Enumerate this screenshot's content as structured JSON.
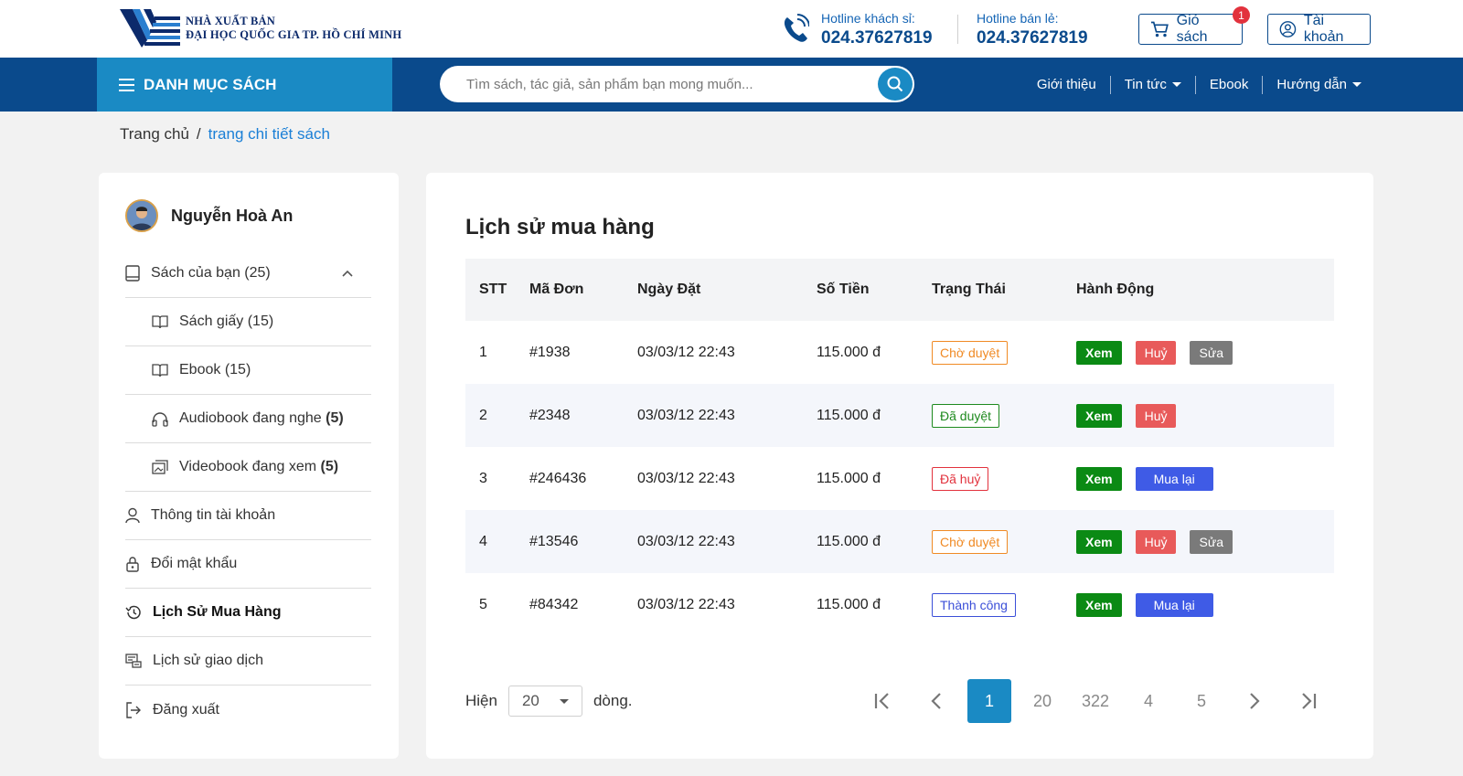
{
  "header": {
    "logo_line1": "NHÀ XUẤT BẢN",
    "logo_line2": "ĐẠI HỌC QUỐC GIA TP. HỒ CHÍ MINH",
    "hotline_wholesale_label": "Hotline khách sỉ:",
    "hotline_wholesale_number": "024.37627819",
    "hotline_retail_label": "Hotline bán lẻ:",
    "hotline_retail_number": "024.37627819",
    "cart_label": "Giỏ sách",
    "cart_count": "1",
    "account_label": "Tài khoản"
  },
  "nav": {
    "category_label": "DANH MỤC SÁCH",
    "search_placeholder": "Tìm sách, tác giả, sản phẩm bạn mong muốn...",
    "links": [
      "Giới thiệu",
      "Tin tức",
      "Ebook",
      "Hướng dẫn"
    ]
  },
  "breadcrumb": {
    "home": "Trang chủ",
    "separator": "/",
    "current": "trang chi tiết  sách"
  },
  "sidebar": {
    "user_name": "Nguyễn Hoà An",
    "items": [
      {
        "label": "Sách của bạn (25)",
        "icon": "book-icon"
      },
      {
        "label": "Sách giấy (15)",
        "icon": "open-book-icon"
      },
      {
        "label": "Ebook (15)",
        "icon": "open-book-icon"
      },
      {
        "label": "Audiobook đang nghe",
        "count": "(5)",
        "icon": "headphones-icon"
      },
      {
        "label": "Videobook đang xem",
        "count": "(5)",
        "icon": "video-icon"
      },
      {
        "label": "Thông tin tài khoản",
        "icon": "user-icon"
      },
      {
        "label": "Đổi mật khẩu",
        "icon": "lock-icon"
      },
      {
        "label": "Lịch Sử Mua Hàng",
        "icon": "history-icon"
      },
      {
        "label": "Lịch sử giao dịch",
        "icon": "transaction-icon"
      },
      {
        "label": "Đăng xuất",
        "icon": "logout-icon"
      }
    ]
  },
  "main": {
    "title": "Lịch sử mua hàng",
    "columns": [
      "STT",
      "Mã Đơn",
      "Ngày Đặt",
      "Số Tiền",
      "Trạng Thái",
      "Hành Động"
    ],
    "rows": [
      {
        "stt": "1",
        "code": "#1938",
        "date": "03/03/12 22:43",
        "amount": "115.000 đ",
        "status": "Chờ duyệt",
        "actions": [
          "Xem",
          "Huỷ",
          "Sửa"
        ]
      },
      {
        "stt": "2",
        "code": "#2348",
        "date": "03/03/12 22:43",
        "amount": "115.000 đ",
        "status": "Đã duyệt",
        "actions": [
          "Xem",
          "Huỷ"
        ]
      },
      {
        "stt": "3",
        "code": "#246436",
        "date": "03/03/12 22:43",
        "amount": "115.000 đ",
        "status": "Đã huỷ",
        "actions": [
          "Xem",
          "Mua lại"
        ]
      },
      {
        "stt": "4",
        "code": "#13546",
        "date": "03/03/12 22:43",
        "amount": "115.000 đ",
        "status": "Chờ duyệt",
        "actions": [
          "Xem",
          "Huỷ",
          "Sửa"
        ]
      },
      {
        "stt": "5",
        "code": "#84342",
        "date": "03/03/12 22:43",
        "amount": "115.000 đ",
        "status": "Thành công",
        "actions": [
          "Xem",
          "Mua lại"
        ]
      }
    ],
    "colors": {
      "Chờ duyệt": "#f08a24",
      "Đã duyệt": "#1e8a1e",
      "Đã huỷ": "#e2323d",
      "Thành công": "#3b4fd8",
      "Xem": "#0b8a14",
      "Huỷ": "#e85a5a",
      "Sửa": "#7a7a7a",
      "Mua lại": "#3f5be6"
    }
  },
  "pager": {
    "show_label": "Hiện",
    "page_size": "20",
    "rows_label": "dòng.",
    "pages": [
      "1",
      "20",
      "322",
      "4",
      "5"
    ],
    "current_page": "1"
  }
}
